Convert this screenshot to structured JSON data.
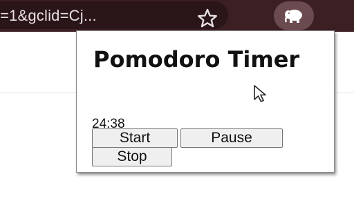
{
  "browser": {
    "url_fragment": "=1&gclid=Cj...",
    "star_icon": "star-outline-icon",
    "extension_icon": "elephant-icon"
  },
  "popup": {
    "title": "Pomodoro Timer",
    "timer": "24:38",
    "buttons": {
      "start": "Start",
      "pause": "Pause",
      "stop": "Stop"
    }
  },
  "colors": {
    "chrome_bar": "#3b1f23",
    "omnibox": "#2a1518",
    "extension_button": "#6b4a50",
    "button_bg": "#efefef"
  }
}
